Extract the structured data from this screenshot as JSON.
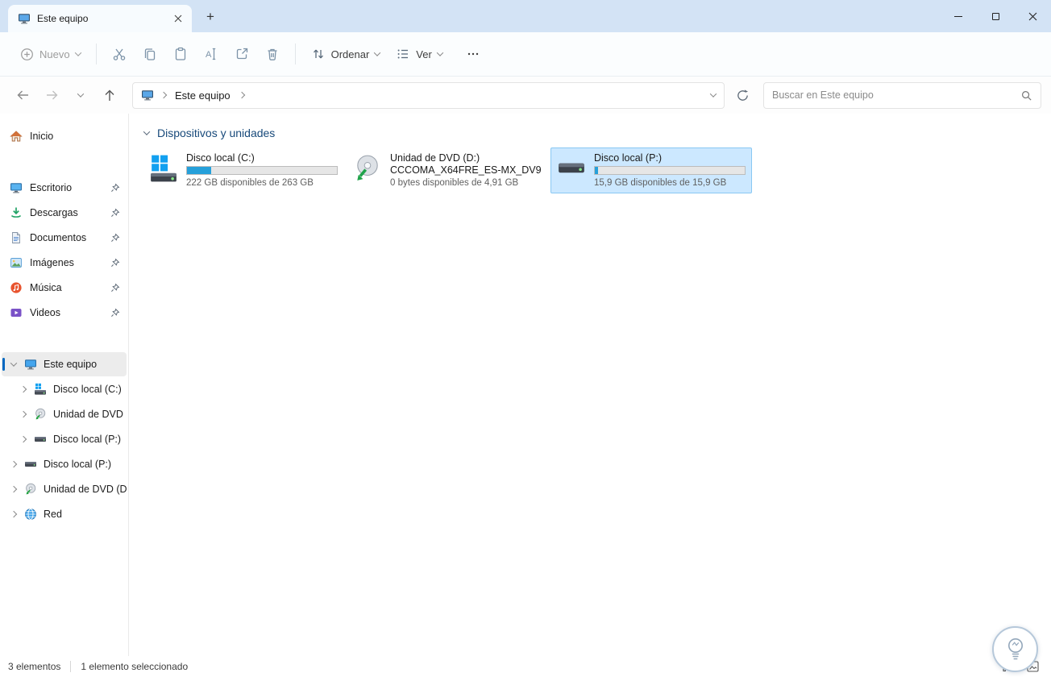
{
  "window": {
    "tab_title": "Este equipo"
  },
  "toolbar": {
    "new": "Nuevo",
    "sort": "Ordenar",
    "view": "Ver"
  },
  "navbar": {
    "breadcrumb_root": "Este equipo",
    "search_placeholder": "Buscar en Este equipo"
  },
  "sidebar": {
    "home": "Inicio",
    "pinned": [
      {
        "label": "Escritorio"
      },
      {
        "label": "Descargas"
      },
      {
        "label": "Documentos"
      },
      {
        "label": "Imágenes"
      },
      {
        "label": "Música"
      },
      {
        "label": "Videos"
      }
    ],
    "tree": {
      "this_pc": "Este equipo",
      "children": [
        {
          "label": "Disco local (C:)"
        },
        {
          "label": "Unidad de DVD (D:)"
        },
        {
          "label": "Disco local (P:)"
        }
      ],
      "siblings": [
        {
          "label": "Disco local (P:)"
        },
        {
          "label": "Unidad de DVD (D:)"
        },
        {
          "label": "Red"
        }
      ]
    }
  },
  "main": {
    "group_title": "Dispositivos y unidades",
    "drives": [
      {
        "name": "Disco local (C:)",
        "detail": "222 GB disponibles de 263 GB",
        "fill_pct": "16%"
      },
      {
        "name": "Unidad de DVD (D:)",
        "volume": "CCCOMA_X64FRE_ES-MX_DV9",
        "detail": "0 bytes disponibles de 4,91 GB"
      },
      {
        "name": "Disco local (P:)",
        "detail": "15,9 GB disponibles de 15,9 GB",
        "fill_pct": "2%"
      }
    ]
  },
  "statusbar": {
    "count": "3 elementos",
    "selected": "1 elemento seleccionado"
  },
  "colors": {
    "accent": "#0067c0",
    "selection_bg": "#cce8ff",
    "selection_border": "#89c8f2",
    "progress_fill": "#26a0da",
    "tabbar_bg": "#d3e3f5"
  }
}
